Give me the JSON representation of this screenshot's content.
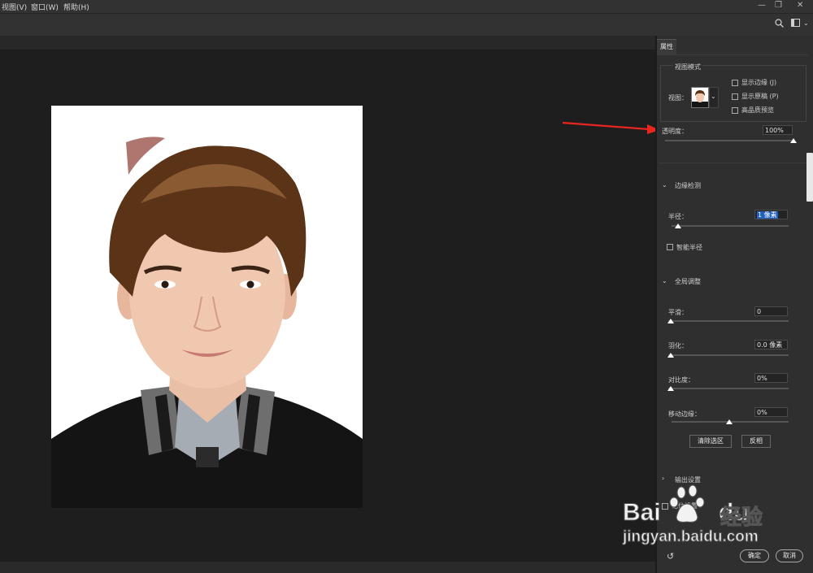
{
  "menubar": {
    "items": [
      "视图(V)",
      "窗口(W)",
      "帮助(H)"
    ],
    "window_controls": [
      "minimize-icon",
      "restore-icon",
      "close-icon"
    ]
  },
  "toolbar": {
    "icons": [
      "search-icon",
      "workspace-icon",
      "chevron-down-icon"
    ]
  },
  "panel": {
    "tab": "属性",
    "view_mode": {
      "title": "视图模式",
      "view_label": "视图：",
      "options": [
        {
          "label": "显示边缘 (J)",
          "checked": false
        },
        {
          "label": "显示原稿 (P)",
          "checked": false
        },
        {
          "label": "高品质预览",
          "checked": false
        }
      ]
    },
    "transparency": {
      "label": "透明度：",
      "value": "100%",
      "fraction": 1.0
    },
    "edge_detection": {
      "title": "边缘检测",
      "radius_label": "半径：",
      "radius_value": "1 像素",
      "smart_radius": "智能半径"
    },
    "global_refine": {
      "title": "全局调整",
      "smooth": {
        "label": "平滑：",
        "value": "0"
      },
      "feather": {
        "label": "羽化：",
        "value": "0.0 像素"
      },
      "contrast": {
        "label": "对比度：",
        "value": "0%"
      },
      "shift_edge": {
        "label": "移动边缘：",
        "value": "0%"
      },
      "clear_selection": "清除选区",
      "invert": "反相"
    },
    "output": {
      "title": "输出设置"
    },
    "remember": "记住设置",
    "ok": "确定",
    "cancel": "取消"
  },
  "watermark": {
    "brand": "Bai",
    "brand2": "du",
    "cn": "经验",
    "url": "jingyan.baidu.com"
  },
  "colors": {
    "arrow": "#e8261f",
    "panel_bg": "#2f2f2f",
    "canvas_bg": "#1e1e1e"
  }
}
